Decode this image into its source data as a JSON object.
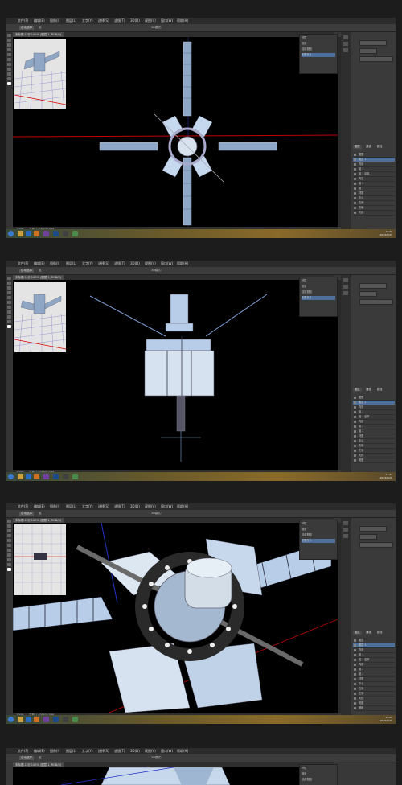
{
  "app": {
    "menu": [
      "文件(F)",
      "编辑(E)",
      "图像(I)",
      "图层(L)",
      "文字(Y)",
      "选择(S)",
      "滤镜(T)",
      "3D(D)",
      "视图(V)",
      "窗口(W)",
      "帮助(H)"
    ],
    "options_mode": "3D模式:",
    "options_select": "自动选择",
    "options_group": "组"
  },
  "screens": [
    {
      "doc_tab": "未标题-1 @ 100% (图层 1, RGB/8)",
      "status_zoom": "100%",
      "status_doc": "文档:1.03M/5.00M",
      "props_rows": [
        "环境",
        "场景",
        "当前视图",
        "无限光 1"
      ],
      "panel_tabs": [
        "图层",
        "通道",
        "路径"
      ],
      "layers": [
        "图层",
        "图层 1",
        "背景",
        "组 1",
        "组 1 副本",
        "内容",
        "组 2",
        "组 3",
        "材质",
        "中心",
        "右侧",
        "左侧",
        "天线"
      ],
      "clock": "11:26",
      "date": "2015/6/29"
    },
    {
      "doc_tab": "未标题-1 @ 100% (图层 1, RGB/8)",
      "status_zoom": "100%",
      "status_doc": "文档:1.03M/5.00M",
      "props_rows": [
        "环境",
        "场景",
        "当前视图",
        "无限光 1"
      ],
      "panel_tabs": [
        "图层",
        "通道",
        "路径"
      ],
      "layers": [
        "图层",
        "图层 1",
        "背景",
        "组 1",
        "组 1 副本",
        "内容",
        "组 2",
        "组 3",
        "材质",
        "中心",
        "右侧",
        "左侧",
        "天线",
        "底座"
      ],
      "clock": "11:27",
      "date": "2015/6/29"
    },
    {
      "doc_tab": "未标题-1 @ 100% (图层 1, RGB/8)",
      "status_zoom": "100%",
      "status_doc": "文档:1.03M/5.00M",
      "props_rows": [
        "环境",
        "场景",
        "当前视图",
        "无限光 1"
      ],
      "panel_tabs": [
        "图层",
        "通道",
        "路径"
      ],
      "layers": [
        "图层",
        "图层 1",
        "背景",
        "组 1",
        "组 1 副本",
        "内容",
        "组 2",
        "组 3",
        "材质",
        "中心",
        "右侧",
        "左侧",
        "天线",
        "底座",
        "侧板"
      ],
      "clock": "11:29",
      "date": "2015/6/29"
    },
    {
      "doc_tab": "未标题-1 @ 100% (图层 1, RGB/8)",
      "props_rows": [
        "环境",
        "场景",
        "当前视图",
        "无限光 1"
      ]
    }
  ],
  "colors": {
    "accent": "#4d6f9a",
    "canvas": "#000000",
    "satellite": "#aac6e8",
    "axis_red": "#c00000"
  }
}
